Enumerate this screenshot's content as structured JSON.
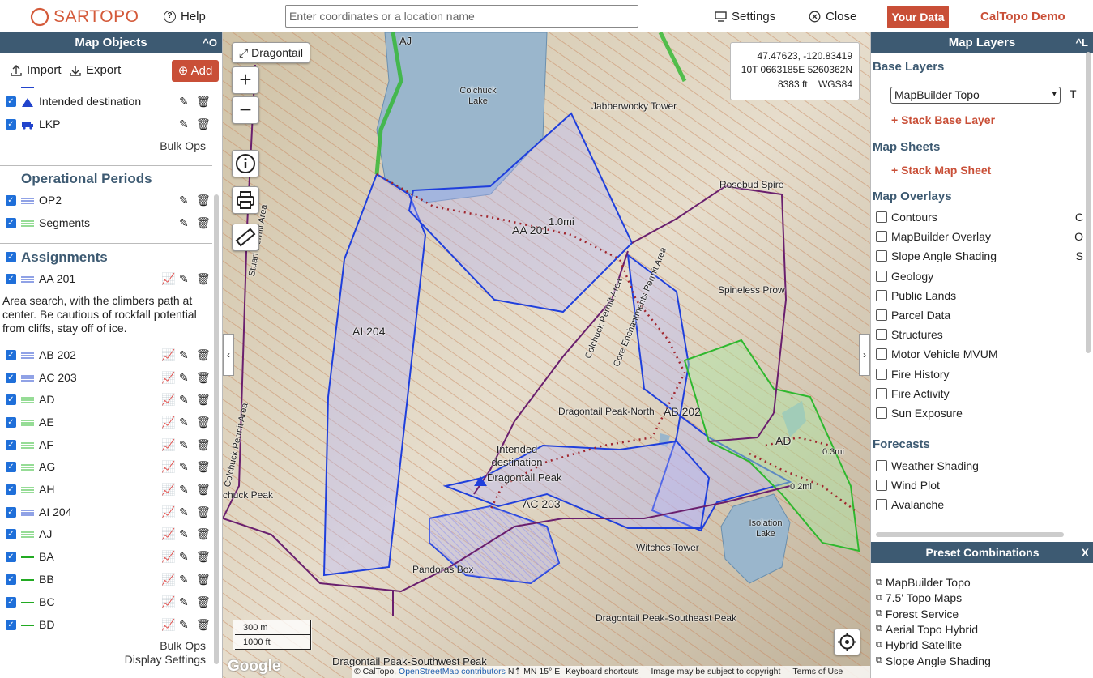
{
  "topbar": {
    "logo_text": "SARTOPO",
    "help": "Help",
    "search_placeholder": "Enter coordinates or a location name",
    "settings": "Settings",
    "close": "Close",
    "your_data": "Your Data",
    "demo": "CalTopo Demo"
  },
  "left_panel": {
    "title": "Map Objects",
    "collapse": "^O",
    "import": "Import",
    "export": "Export",
    "add": "Add",
    "top_items": [
      {
        "label": "Intended destination"
      },
      {
        "label": "LKP"
      }
    ],
    "bulk_ops": "Bulk Ops",
    "operational_periods_title": "Operational Periods",
    "op_items": [
      {
        "label": "OP2"
      },
      {
        "label": "Segments"
      }
    ],
    "assignments_title": "Assignments",
    "assignments": [
      {
        "label": "AA 201"
      },
      {
        "label": "AB 202"
      },
      {
        "label": "AC 203"
      },
      {
        "label": "AD"
      },
      {
        "label": "AE"
      },
      {
        "label": "AF"
      },
      {
        "label": "AG"
      },
      {
        "label": "AH"
      },
      {
        "label": "AI 204"
      },
      {
        "label": "AJ"
      },
      {
        "label": "BA"
      },
      {
        "label": "BB"
      },
      {
        "label": "BC"
      },
      {
        "label": "BD"
      }
    ],
    "aa201_description": "Area search, with the climbers path at center. Be cautious of rockfall potential from cliffs, stay off of ice.",
    "bulk_ops_2": "Bulk Ops",
    "display_settings": "Display Settings"
  },
  "map": {
    "dragontail_button": "Dragontail",
    "coords": {
      "latlon": "47.47623, -120.83419",
      "utm": "10T 0663185E 5260362N",
      "elev": "8383 ft",
      "datum": "WGS84"
    },
    "labels": [
      {
        "text": "AJ"
      },
      {
        "text": "Colchuck Lake"
      },
      {
        "text": "Jabberwocky Tower"
      },
      {
        "text": "Rosebud Spire"
      },
      {
        "text": "AA 201"
      },
      {
        "text": "1.0mi"
      },
      {
        "text": "Spineless Prow"
      },
      {
        "text": "AI 204"
      },
      {
        "text": "Dragontail Peak-North"
      },
      {
        "text": "AB 202"
      },
      {
        "text": "AD"
      },
      {
        "text": "0.3mi"
      },
      {
        "text": "0.2mi"
      },
      {
        "text": "Intended destination"
      },
      {
        "text": "Dragontail Peak"
      },
      {
        "text": "AC 203"
      },
      {
        "text": "Isolation Lake"
      },
      {
        "text": "Witches Tower"
      },
      {
        "text": "Pandoras Box"
      },
      {
        "text": "Dragontail Peak-Southeast Peak"
      },
      {
        "text": "Dragontail Peak-Southwest Peak"
      },
      {
        "text": "Colchuck Permit Area"
      },
      {
        "text": "Core Enchantments Permit Area"
      },
      {
        "text": "Stuart Permit Area"
      },
      {
        "text": "Colchuck Permit Area"
      },
      {
        "text": "chuck Peak"
      }
    ],
    "scale_m": "300 m",
    "scale_ft": "1000 ft",
    "google": "Google",
    "attribution": {
      "caltopo": "© CalTopo,",
      "osm": "OpenStreetMap contributors",
      "declination": "N⇡ MN 15° E",
      "shortcuts": "Keyboard shortcuts",
      "copyright": "Image may be subject to copyright",
      "terms": "Terms of Use"
    }
  },
  "right_panel": {
    "title": "Map Layers",
    "collapse": "^L",
    "base_layers_title": "Base Layers",
    "base_layer_value": "MapBuilder Topo",
    "base_layer_key": "T",
    "stack_base": "+ Stack Base Layer",
    "map_sheets_title": "Map Sheets",
    "stack_sheet": "+ Stack Map Sheet",
    "overlays_title": "Map Overlays",
    "overlays": [
      {
        "label": "Contours",
        "key": "C"
      },
      {
        "label": "MapBuilder Overlay",
        "key": "O"
      },
      {
        "label": "Slope Angle Shading",
        "key": "S"
      },
      {
        "label": "Geology",
        "key": ""
      },
      {
        "label": "Public Lands",
        "key": ""
      },
      {
        "label": "Parcel Data",
        "key": ""
      },
      {
        "label": "Structures",
        "key": ""
      },
      {
        "label": "Motor Vehicle MVUM",
        "key": ""
      },
      {
        "label": "Fire History",
        "key": ""
      },
      {
        "label": "Fire Activity",
        "key": ""
      },
      {
        "label": "Sun Exposure",
        "key": ""
      }
    ],
    "forecasts_title": "Forecasts",
    "forecasts": [
      {
        "label": "Weather Shading"
      },
      {
        "label": "Wind Plot"
      },
      {
        "label": "Avalanche"
      }
    ],
    "preset_title": "Preset Combinations",
    "preset_close": "X",
    "presets": [
      {
        "label": "MapBuilder Topo"
      },
      {
        "label": "7.5' Topo Maps"
      },
      {
        "label": "Forest Service"
      },
      {
        "label": "Aerial Topo Hybrid"
      },
      {
        "label": "Hybrid Satellite"
      },
      {
        "label": "Slope Angle Shading"
      }
    ]
  },
  "colors": {
    "brand": "#c94f37",
    "header": "#3d5a72",
    "assignment_blue": "#1f3fdc",
    "green": "#2eb82e",
    "purple": "#6a1f6e"
  }
}
